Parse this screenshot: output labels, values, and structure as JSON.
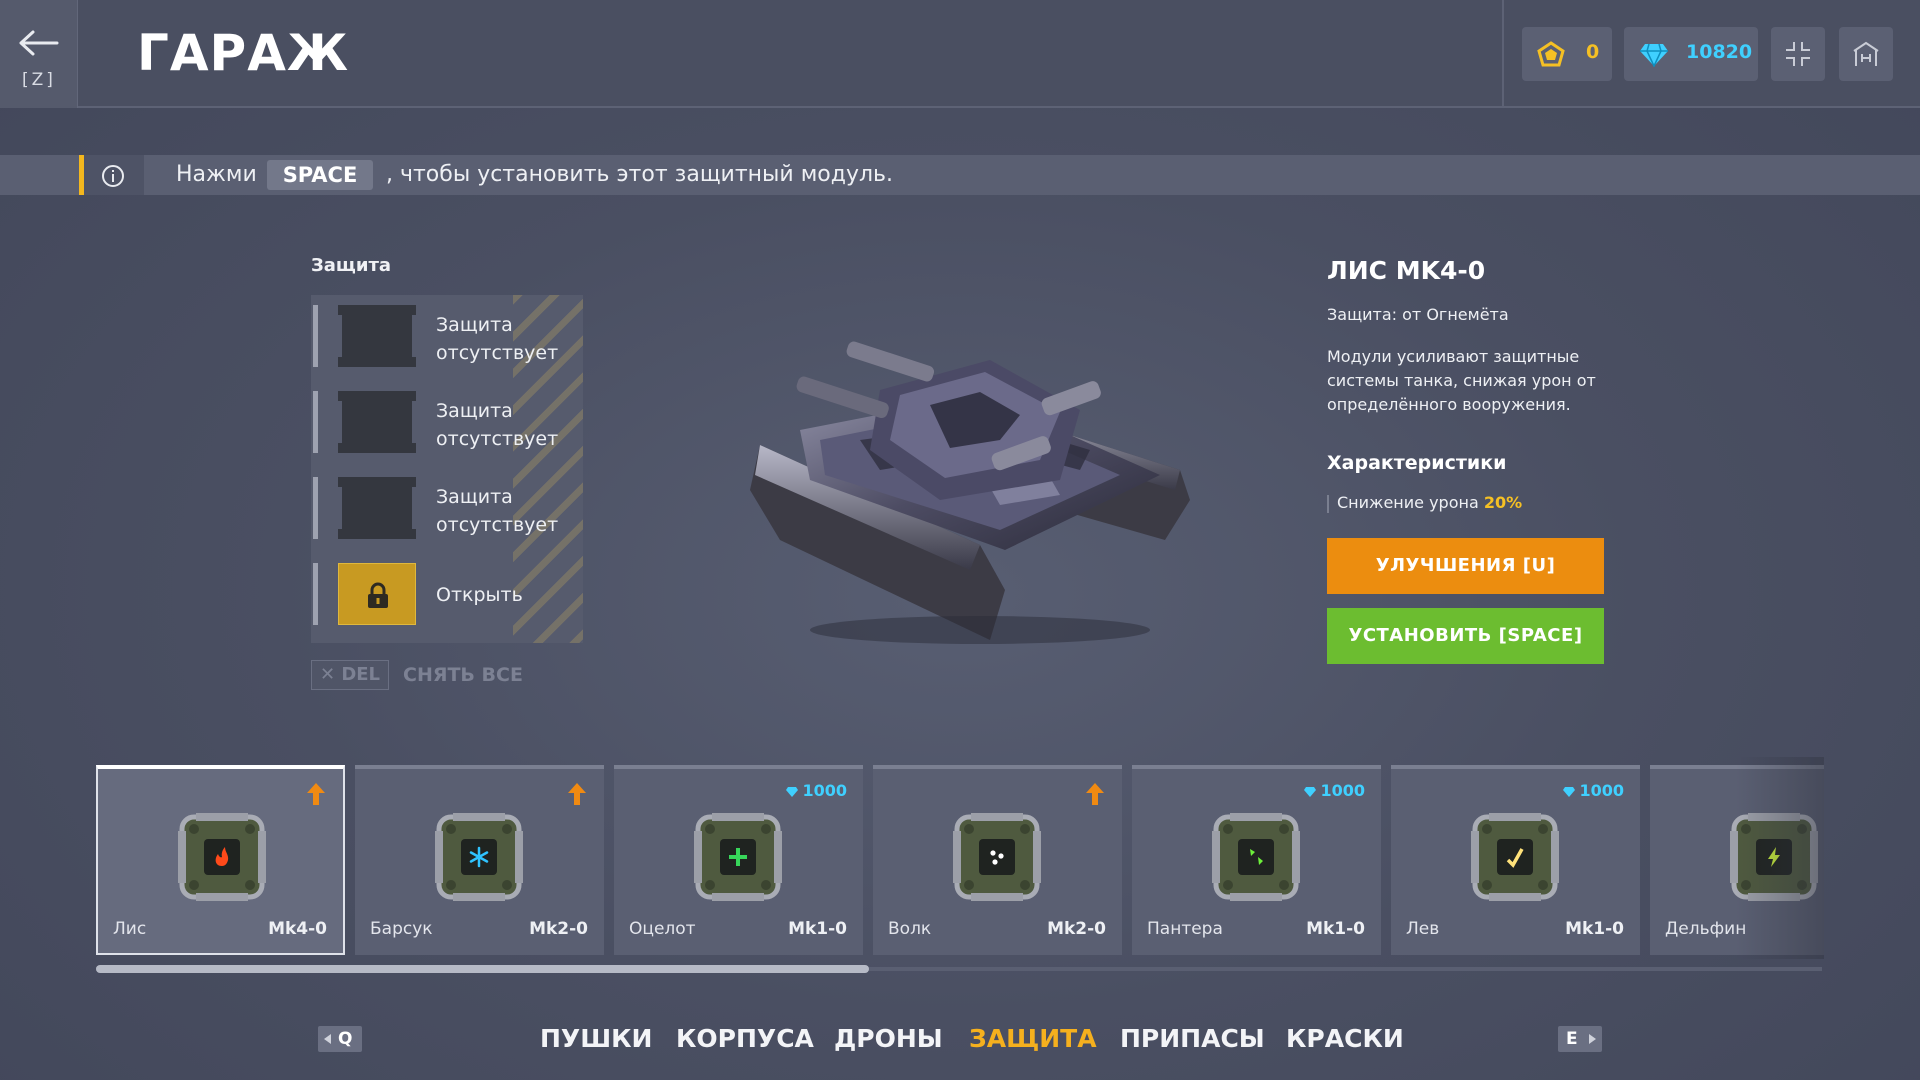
{
  "header": {
    "back_key": "[Z]",
    "title": "ГАРАЖ",
    "crystals": "0",
    "diamonds": "10820",
    "icons": [
      "back-arrow-icon",
      "crystal-icon",
      "diamond-icon",
      "fullscreen-icon",
      "home-icon"
    ]
  },
  "hint": {
    "prefix": "Нажми",
    "key": "SPACE",
    "suffix": ", чтобы установить этот защитный модуль."
  },
  "slots": {
    "title": "Защита",
    "items": [
      {
        "label_line1": "Защита",
        "label_line2": "отсутствует"
      },
      {
        "label_line1": "Защита",
        "label_line2": "отсутствует"
      },
      {
        "label_line1": "Защита",
        "label_line2": "отсутствует"
      },
      {
        "label_line1": "Открыть",
        "label_line2": ""
      }
    ],
    "remove_key": "✕ DEL",
    "remove_label": "СНЯТЬ ВСЕ"
  },
  "info": {
    "title": "ЛИС MK4-0",
    "type": "Защита: от Огнемёта",
    "description": "Модули усиливают защитные системы танка, снижая урон от определённого вооружения.",
    "characteristics_title": "Характеристики",
    "damage_reduction_label": "Снижение урона",
    "damage_reduction_value": "20%",
    "upgrade_button": "УЛУЧШЕНИЯ [U]",
    "install_button": "УСТАНОВИТЬ [SPACE]"
  },
  "items": [
    {
      "name": "Лис",
      "level": "Mk4-0",
      "price": "",
      "upgrade": true,
      "selected": true,
      "symbol_color": "#ff4a1a",
      "icon": "flame-icon"
    },
    {
      "name": "Барсук",
      "level": "Mk2-0",
      "price": "",
      "upgrade": true,
      "selected": false,
      "symbol_color": "#2fc3ff",
      "icon": "snowflake-icon"
    },
    {
      "name": "Оцелот",
      "level": "Mk1-0",
      "price": "1000",
      "upgrade": false,
      "selected": false,
      "symbol_color": "#37d65a",
      "icon": "plus-icon"
    },
    {
      "name": "Волк",
      "level": "Mk2-0",
      "price": "",
      "upgrade": true,
      "selected": false,
      "symbol_color": "#ffffff",
      "icon": "dots-icon"
    },
    {
      "name": "Пантера",
      "level": "Mk1-0",
      "price": "1000",
      "upgrade": false,
      "selected": false,
      "symbol_color": "#6cf03a",
      "icon": "shards-icon"
    },
    {
      "name": "Лев",
      "level": "Mk1-0",
      "price": "1000",
      "upgrade": false,
      "selected": false,
      "symbol_color": "#ffe27a",
      "icon": "check-icon"
    },
    {
      "name": "Дельфин",
      "level": "",
      "price": "",
      "upgrade": false,
      "selected": false,
      "symbol_color": "#c8f03a",
      "icon": "lightning-icon"
    }
  ],
  "scroll_position": 0.45,
  "tabs": {
    "prev_key": "Q",
    "next_key": "E",
    "items": [
      "ПУШКИ",
      "КОРПУСА",
      "ДРОНЫ",
      "ЗАЩИТА",
      "ПРИПАСЫ",
      "КРАСКИ"
    ],
    "active": "ЗАЩИТА"
  },
  "colors": {
    "accent_orange": "#ec8d0f",
    "accent_green": "#6cbd30",
    "tab_active": "#f5b01e",
    "crystal": "#f5c024",
    "diamond": "#3fd0ff"
  }
}
